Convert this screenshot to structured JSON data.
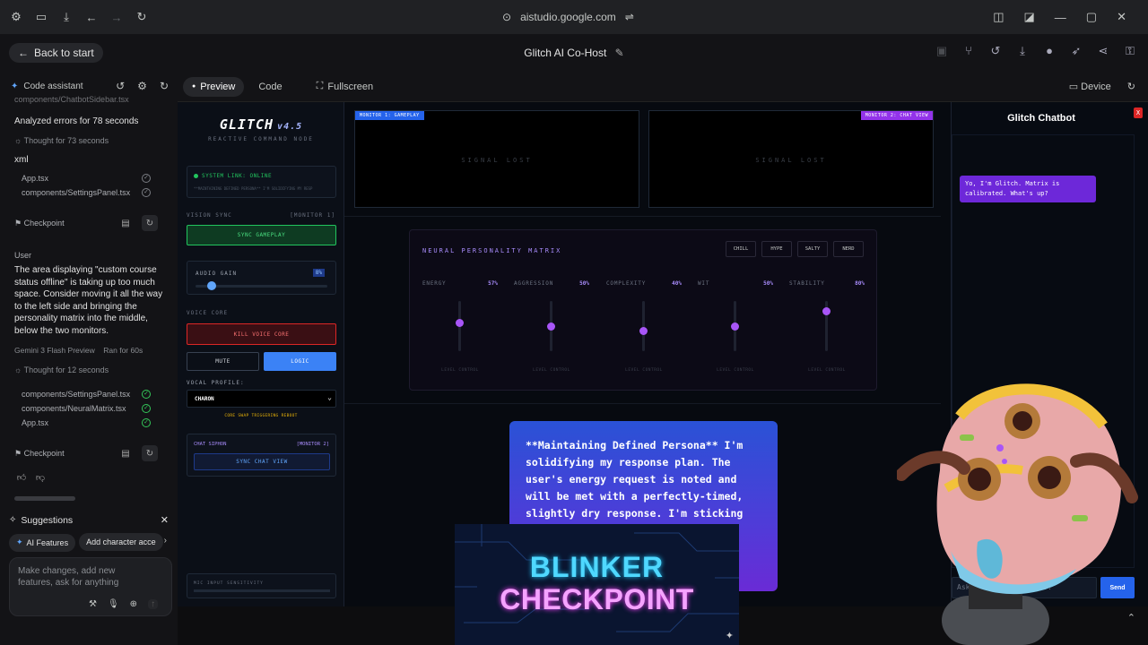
{
  "browser": {
    "url": "aistudio.google.com"
  },
  "header": {
    "back_label": "Back to start",
    "title": "Glitch AI Co-Host"
  },
  "assistant": {
    "label": "Code assistant",
    "cut_file": "components/ChatbotSidebar.tsx",
    "analyzed": "Analyzed errors for 78 seconds",
    "thought1": "Thought for 73 seconds",
    "lang": "xml",
    "files1": [
      "App.tsx",
      "components/SettingsPanel.tsx"
    ],
    "checkpoint_label": "Checkpoint",
    "user_label": "User",
    "user_message": "The area displaying \"custom course status offline\" is taking up too much space. Consider moving it all the way to the left side and bringing the personality matrix into the middle, below the two monitors.",
    "model": "Gemini 3 Flash Preview",
    "ran": "Ran for 60s",
    "thought2": "Thought for 12 seconds",
    "files2": [
      "components/SettingsPanel.tsx",
      "components/NeuralMatrix.tsx",
      "App.tsx"
    ],
    "suggestions_label": "Suggestions",
    "chips": [
      "AI Features",
      "Add character acce"
    ],
    "prompt_placeholder": "Make changes, add new features, ask for anything"
  },
  "tabs": {
    "preview": "Preview",
    "code": "Code",
    "fullscreen": "Fullscreen",
    "device": "Device"
  },
  "app": {
    "logo": "GLITCH",
    "version": "v4.5",
    "subtitle": "REACTIVE COMMAND NODE",
    "system_link": "SYSTEM LINK: ONLINE",
    "ticker": "**MAINTAINING DEFINED PERSONA** I'M SOLIDIFYING MY RESP",
    "vision_sync": "VISION SYNC",
    "monitor1_ref": "[MONITOR 1]",
    "sync_gameplay": "SYNC GAMEPLAY",
    "audio_gain": "AUDIO GAIN",
    "audio_gain_value": "8%",
    "audio_gain_fraction": 0.08,
    "voice_core": "VOICE CORE",
    "kill_voice": "KILL VOICE CORE",
    "mute": "MUTE",
    "logic": "LOGIC",
    "vocal_profile": "VOCAL PROFILE:",
    "vocal_value": "CHARON",
    "core_swap": "CORE SWAP TRIGGERING REBOOT",
    "chat_siphon": "CHAT SIPHON",
    "monitor2_ref": "[MONITOR 2]",
    "sync_chat": "SYNC CHAT VIEW",
    "mic_sensitivity": "MIC INPUT SENSITIVITY",
    "monitor1_tag": "MONITOR 1: GAMEPLAY",
    "monitor2_tag": "MONITOR 2: CHAT VIEW",
    "signal_lost": "SIGNAL LOST",
    "matrix_title": "NEURAL PERSONALITY MATRIX",
    "modes": [
      "CHILL",
      "HYPE",
      "SALTY",
      "NERD"
    ],
    "level_control": "LEVEL CONTROL",
    "sliders": [
      {
        "name": "ENERGY",
        "value": "57%",
        "level": 0.57
      },
      {
        "name": "AGGRESSION",
        "value": "50%",
        "level": 0.5
      },
      {
        "name": "COMPLEXITY",
        "value": "40%",
        "level": 0.4
      },
      {
        "name": "WIT",
        "value": "50%",
        "level": 0.5
      },
      {
        "name": "STABILITY",
        "value": "80%",
        "level": 0.8
      }
    ],
    "thought_text": "**Maintaining Defined Persona** I'm solidifying my response plan. The user's energy request is noted and will be met with a perfectly-timed, slightly dry response. I'm sticking to the script;"
  },
  "chatbot": {
    "title": "Glitch Chatbot",
    "close": "X",
    "message": "Yo, I'm Glitch. Matrix is calibrated. What's up?",
    "input_placeholder": "Ask Glitch anything...",
    "send": "Send"
  },
  "overlay": {
    "line1": "BLINKER",
    "line2": "CHECKPOINT"
  }
}
